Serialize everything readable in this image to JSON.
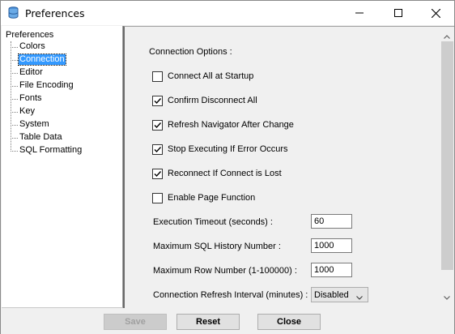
{
  "window": {
    "title": "Preferences",
    "app_icon": "database-icon"
  },
  "window_controls": {
    "minimize": "minimize-icon",
    "maximize": "maximize-icon",
    "close": "close-icon"
  },
  "tree": {
    "root": "Preferences",
    "items": [
      {
        "label": "Colors"
      },
      {
        "label": "Connection",
        "selected": true
      },
      {
        "label": "Editor"
      },
      {
        "label": "File Encoding"
      },
      {
        "label": "Fonts"
      },
      {
        "label": "Key"
      },
      {
        "label": "System"
      },
      {
        "label": "Table Data"
      },
      {
        "label": "SQL Formatting"
      }
    ]
  },
  "panel": {
    "section_title": "Connection Options :",
    "options": [
      {
        "label": "Connect All at Startup",
        "checked": false
      },
      {
        "label": "Confirm Disconnect All",
        "checked": true
      },
      {
        "label": "Refresh Navigator After Change",
        "checked": true
      },
      {
        "label": "Stop Executing If Error Occurs",
        "checked": true
      },
      {
        "label": "Reconnect If Connect is Lost",
        "checked": true
      },
      {
        "label": "Enable Page Function",
        "checked": false
      }
    ],
    "fields": [
      {
        "label": "Execution Timeout (seconds) :",
        "value": "60"
      },
      {
        "label": "Maximum SQL History Number :",
        "value": "1000"
      },
      {
        "label": "Maximum Row Number (1-100000) :",
        "value": "1000"
      }
    ],
    "refresh_interval": {
      "label": "Connection Refresh Interval (minutes) :",
      "value": "Disabled"
    }
  },
  "buttons": {
    "save": "Save",
    "reset": "Reset",
    "close": "Close"
  },
  "colors": {
    "selection": "#3399ff",
    "background": "#f0f0f0"
  }
}
